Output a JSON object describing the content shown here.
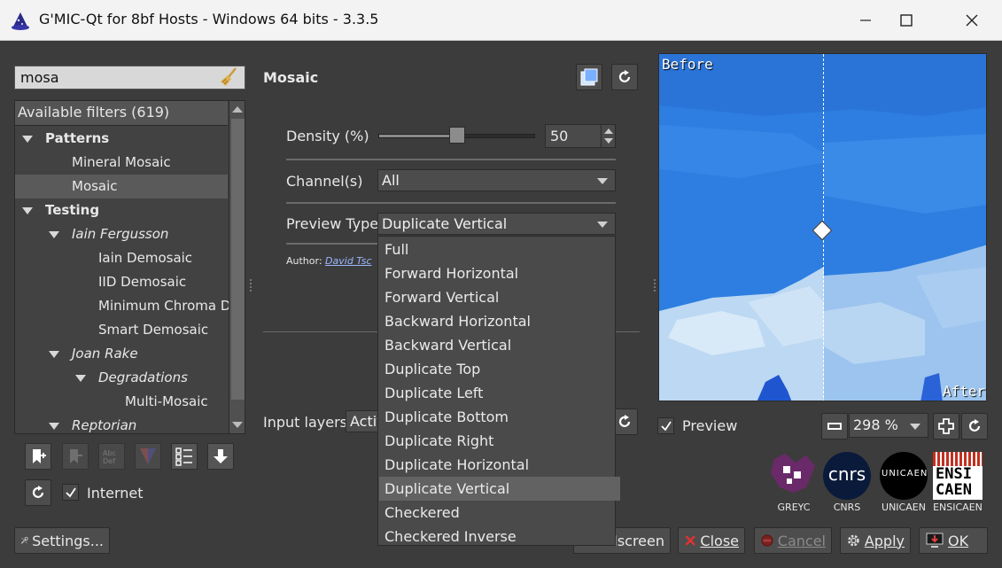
{
  "window": {
    "title": "G'MIC-Qt for 8bf Hosts - Windows 64 bits - 3.3.5",
    "controls": [
      "minimize-icon",
      "maximize-icon",
      "close-icon"
    ]
  },
  "search": {
    "value": "mosa"
  },
  "tree": {
    "header": "Available filters (619)",
    "rows": [
      {
        "label": "Patterns",
        "level": 0,
        "style": "bold",
        "expanded": true
      },
      {
        "label": "Mineral Mosaic",
        "level": 1
      },
      {
        "label": "Mosaic",
        "level": 1,
        "selected": true
      },
      {
        "label": "Testing",
        "level": 0,
        "style": "bold",
        "expanded": true
      },
      {
        "label": "Iain Fergusson",
        "level": 1,
        "style": "italic",
        "expanded": true
      },
      {
        "label": "Iain Demosaic",
        "level": 2
      },
      {
        "label": "IID Demosaic",
        "level": 2
      },
      {
        "label": "Minimum Chroma De",
        "level": 2
      },
      {
        "label": "Smart Demosaic",
        "level": 2
      },
      {
        "label": "Joan Rake",
        "level": 1,
        "style": "italic",
        "expanded": true
      },
      {
        "label": "Degradations",
        "level": 2,
        "style": "italic",
        "expanded": true
      },
      {
        "label": "Multi-Mosaic",
        "level": 3
      },
      {
        "label": "Reptorian",
        "level": 1,
        "style": "italic",
        "expanded": true
      }
    ]
  },
  "internet": {
    "label": "Internet",
    "checked": true
  },
  "settings_button": "Settings...",
  "filter": {
    "title": "Mosaic",
    "density": {
      "label": "Density (%)",
      "value": "50",
      "level_percent": 50
    },
    "channels": {
      "label": "Channel(s)",
      "value": "All"
    },
    "preview_type": {
      "label": "Preview Type",
      "value": "Duplicate Vertical"
    },
    "author": {
      "prefix": "Author:",
      "name": "David Tsc"
    },
    "input_layers": {
      "label": "Input layers",
      "value": "Activ"
    }
  },
  "preview_type_options": [
    "Full",
    "Forward Horizontal",
    "Forward Vertical",
    "Backward Horizontal",
    "Backward Vertical",
    "Duplicate Top",
    "Duplicate Left",
    "Duplicate Bottom",
    "Duplicate Right",
    "Duplicate Horizontal",
    "Duplicate Vertical",
    "Checkered",
    "Checkered Inverse"
  ],
  "preview": {
    "before_label": "Before",
    "after_label": "After",
    "checkbox_label": "Preview",
    "checked": true,
    "zoom": "298 %"
  },
  "logos": [
    "GREYC",
    "CNRS",
    "UNICAEN",
    "ENSICAEN"
  ],
  "logo_text": {
    "cnrs": "cnrs",
    "unicaen": "UNICAEN",
    "ensi": "ENSI",
    "caen": "CAEN"
  },
  "bottom_buttons": {
    "fullscreen": "llscreen",
    "close": "Close",
    "cancel": "Cancel",
    "apply": "Apply",
    "ok": "OK"
  },
  "colors": {
    "preview_sky": "#2c7de0",
    "panel_bg": "#3c3c3c",
    "accent_red": "#e03030"
  }
}
